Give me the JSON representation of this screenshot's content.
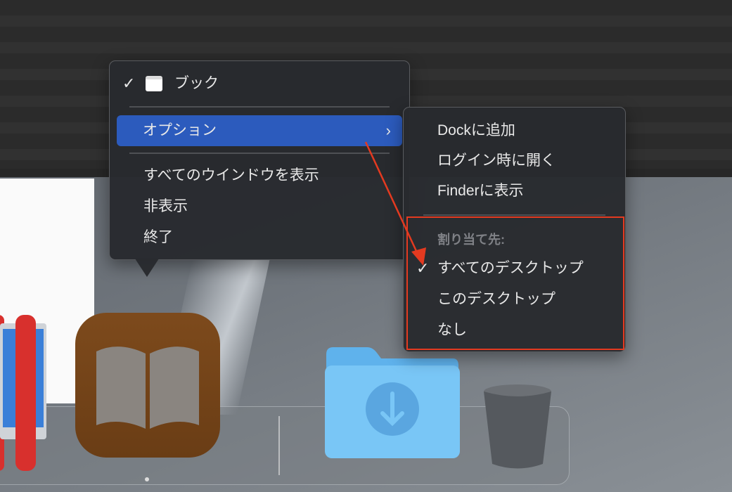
{
  "app_menu": {
    "app_name": "ブック",
    "options_label": "オプション",
    "items": [
      "すべてのウインドウを表示",
      "非表示",
      "終了"
    ]
  },
  "options_submenu": {
    "items": [
      "Dockに追加",
      "ログイン時に開く",
      "Finderに表示"
    ],
    "assign_header": "割り当て先:",
    "assign_options": [
      "すべてのデスクトップ",
      "このデスクトップ",
      "なし"
    ],
    "selected": "すべてのデスクトップ"
  },
  "colors": {
    "highlight": "#2c5bbd",
    "annotation": "#e43a20"
  }
}
